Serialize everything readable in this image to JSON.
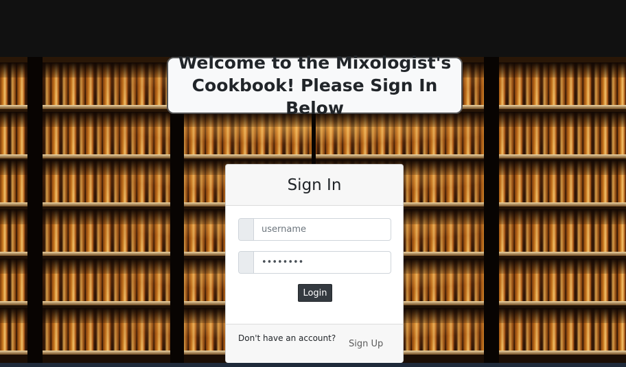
{
  "banner": {
    "title_line1": "Welcome to the Mixologist's",
    "title_line2": "Cookbook! Please Sign In Below"
  },
  "signin": {
    "heading": "Sign In",
    "username": {
      "placeholder": "username",
      "value": ""
    },
    "password": {
      "placeholder": "password",
      "value": "password"
    },
    "login_label": "Login",
    "footer_text": "Don't have an account?",
    "signup_label": "Sign Up"
  },
  "background": {
    "subject": "bar shelves with liquor bottles"
  }
}
